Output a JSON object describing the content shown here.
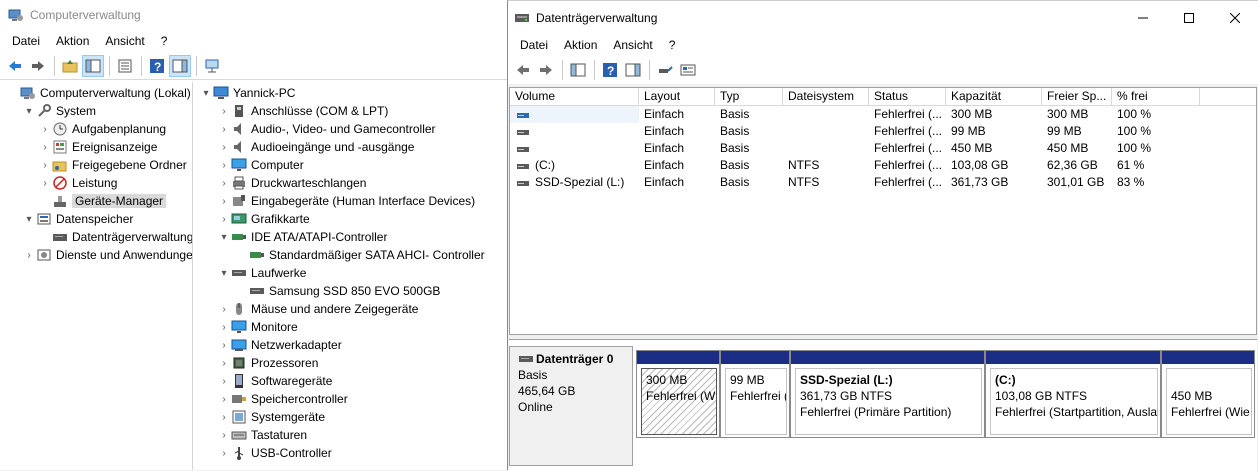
{
  "computer_management": {
    "title": "Computerverwaltung",
    "menu": [
      "Datei",
      "Aktion",
      "Ansicht",
      "?"
    ],
    "tree": [
      {
        "label": "Computerverwaltung (Lokal)",
        "icon": "computer-management-icon",
        "level": 0,
        "twisty": ""
      },
      {
        "label": "System",
        "icon": "tools-icon",
        "level": 1,
        "twisty": "▾"
      },
      {
        "label": "Aufgabenplanung",
        "icon": "clock-icon",
        "level": 2,
        "twisty": "›"
      },
      {
        "label": "Ereignisanzeige",
        "icon": "event-viewer-icon",
        "level": 2,
        "twisty": "›"
      },
      {
        "label": "Freigegebene Ordner",
        "icon": "shared-folder-icon",
        "level": 2,
        "twisty": "›"
      },
      {
        "label": "Leistung",
        "icon": "performance-icon",
        "level": 2,
        "twisty": "›"
      },
      {
        "label": "Geräte-Manager",
        "icon": "device-manager-icon",
        "level": 2,
        "twisty": "",
        "selected": true
      },
      {
        "label": "Datenspeicher",
        "icon": "storage-icon",
        "level": 1,
        "twisty": "▾"
      },
      {
        "label": "Datenträgerverwaltung",
        "icon": "disk-management-icon",
        "level": 2,
        "twisty": ""
      },
      {
        "label": "Dienste und Anwendungen",
        "icon": "services-icon",
        "level": 1,
        "twisty": "›"
      }
    ],
    "devices": [
      {
        "label": "Yannick-PC",
        "icon": "computer-icon",
        "level": 0,
        "twisty": "▾"
      },
      {
        "label": "Anschlüsse (COM & LPT)",
        "icon": "port-icon",
        "level": 1,
        "twisty": "›"
      },
      {
        "label": "Audio-, Video- und Gamecontroller",
        "icon": "speaker-icon",
        "level": 1,
        "twisty": "›"
      },
      {
        "label": "Audioeingänge und -ausgänge",
        "icon": "speaker-icon",
        "level": 1,
        "twisty": "›"
      },
      {
        "label": "Computer",
        "icon": "monitor-icon",
        "level": 1,
        "twisty": "›"
      },
      {
        "label": "Druckwarteschlangen",
        "icon": "printer-icon",
        "level": 1,
        "twisty": "›"
      },
      {
        "label": "Eingabegeräte (Human Interface Devices)",
        "icon": "hid-icon",
        "level": 1,
        "twisty": "›"
      },
      {
        "label": "Grafikkarte",
        "icon": "display-adapter-icon",
        "level": 1,
        "twisty": "›"
      },
      {
        "label": "IDE ATA/ATAPI-Controller",
        "icon": "ide-controller-icon",
        "level": 1,
        "twisty": "▾"
      },
      {
        "label": "Standardmäßiger SATA AHCI- Controller",
        "icon": "ide-controller-icon",
        "level": 2,
        "twisty": ""
      },
      {
        "label": "Laufwerke",
        "icon": "drive-icon",
        "level": 1,
        "twisty": "▾"
      },
      {
        "label": "Samsung SSD 850 EVO 500GB",
        "icon": "drive-icon",
        "level": 2,
        "twisty": ""
      },
      {
        "label": "Mäuse und andere Zeigegeräte",
        "icon": "mouse-icon",
        "level": 1,
        "twisty": "›"
      },
      {
        "label": "Monitore",
        "icon": "monitor-icon",
        "level": 1,
        "twisty": "›"
      },
      {
        "label": "Netzwerkadapter",
        "icon": "network-adapter-icon",
        "level": 1,
        "twisty": "›"
      },
      {
        "label": "Prozessoren",
        "icon": "processor-icon",
        "level": 1,
        "twisty": "›"
      },
      {
        "label": "Softwaregeräte",
        "icon": "software-device-icon",
        "level": 1,
        "twisty": "›"
      },
      {
        "label": "Speichercontroller",
        "icon": "storage-controller-icon",
        "level": 1,
        "twisty": "›"
      },
      {
        "label": "Systemgeräte",
        "icon": "system-device-icon",
        "level": 1,
        "twisty": "›"
      },
      {
        "label": "Tastaturen",
        "icon": "keyboard-icon",
        "level": 1,
        "twisty": "›"
      },
      {
        "label": "USB-Controller",
        "icon": "usb-icon",
        "level": 1,
        "twisty": "›"
      }
    ]
  },
  "disk_management": {
    "title": "Datenträgerverwaltung",
    "menu": [
      "Datei",
      "Aktion",
      "Ansicht",
      "?"
    ],
    "columns": [
      "Volume",
      "Layout",
      "Typ",
      "Dateisystem",
      "Status",
      "Kapazität",
      "Freier Sp...",
      "% frei"
    ],
    "volumes": [
      {
        "volume": "",
        "layout": "Einfach",
        "type": "Basis",
        "fs": "",
        "status": "Fehlerfrei (...",
        "capacity": "300 MB",
        "free": "300 MB",
        "pct": "100 %"
      },
      {
        "volume": "",
        "layout": "Einfach",
        "type": "Basis",
        "fs": "",
        "status": "Fehlerfrei (...",
        "capacity": "99 MB",
        "free": "99 MB",
        "pct": "100 %"
      },
      {
        "volume": "",
        "layout": "Einfach",
        "type": "Basis",
        "fs": "",
        "status": "Fehlerfrei (...",
        "capacity": "450 MB",
        "free": "450 MB",
        "pct": "100 %"
      },
      {
        "volume": "(C:)",
        "layout": "Einfach",
        "type": "Basis",
        "fs": "NTFS",
        "status": "Fehlerfrei (...",
        "capacity": "103,08 GB",
        "free": "62,36 GB",
        "pct": "61 %"
      },
      {
        "volume": "SSD-Spezial (L:)",
        "layout": "Einfach",
        "type": "Basis",
        "fs": "NTFS",
        "status": "Fehlerfrei (...",
        "capacity": "361,73 GB",
        "free": "301,01 GB",
        "pct": "83 %"
      }
    ],
    "disk": {
      "name": "Datenträger 0",
      "type": "Basis",
      "size": "465,64 GB",
      "state": "Online"
    },
    "partitions": [
      {
        "name": "",
        "line1": "300 MB",
        "line2": "Fehlerfrei (Wi"
      },
      {
        "name": "",
        "line1": "99 MB",
        "line2": "Fehlerfrei ("
      },
      {
        "name": "SSD-Spezial  (L:)",
        "line1": "361,73 GB NTFS",
        "line2": "Fehlerfrei (Primäre Partition)"
      },
      {
        "name": "(C:)",
        "line1": "103,08 GB NTFS",
        "line2": "Fehlerfrei (Startpartition, Ausla"
      },
      {
        "name": "",
        "line1": "450 MB",
        "line2": "Fehlerfrei (Wie"
      }
    ]
  }
}
